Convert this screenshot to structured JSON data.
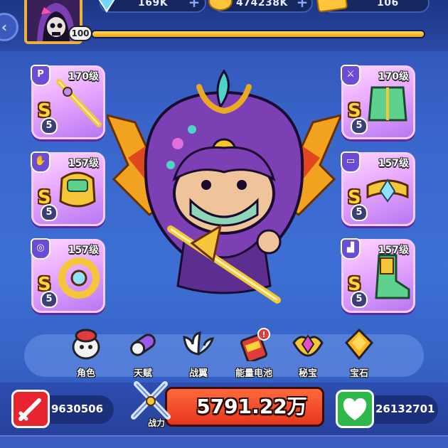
{
  "resources": {
    "gems": {
      "value": "169K",
      "icon": "diamond-icon"
    },
    "coins": {
      "value": "474238K",
      "icon": "gold-coin-icon"
    },
    "tickets": {
      "value": "106",
      "icon": "ticket-icon"
    }
  },
  "player": {
    "level": "100",
    "avatar": "reaper-avatar",
    "xp_fraction": 1.0
  },
  "equipment_left": [
    {
      "slot": "weapon",
      "level": "170级",
      "grade": "S",
      "stars": "5",
      "art": "golden-sword"
    },
    {
      "slot": "gloves",
      "level": "157级",
      "grade": "S",
      "stars": "5",
      "art": "golden-gauntlet"
    },
    {
      "slot": "necklace",
      "level": "157级",
      "grade": "S",
      "stars": "5",
      "art": "golden-amulet"
    }
  ],
  "equipment_right": [
    {
      "slot": "armor",
      "level": "170级",
      "grade": "S",
      "stars": "5",
      "art": "jade-armor"
    },
    {
      "slot": "belt",
      "level": "157级",
      "grade": "S",
      "stars": "5",
      "art": "golden-belt"
    },
    {
      "slot": "boots",
      "level": "157级",
      "grade": "S",
      "stars": "5",
      "art": "jade-boots"
    }
  ],
  "menu": [
    {
      "label": "角色",
      "icon": "character-icon"
    },
    {
      "label": "天赋",
      "icon": "talent-capsule-icon"
    },
    {
      "label": "战翼",
      "icon": "wings-icon"
    },
    {
      "label": "能量电池",
      "icon": "energy-battery-icon",
      "badge": "!"
    },
    {
      "label": "秘宝",
      "icon": "treasure-icon"
    },
    {
      "label": "宝石",
      "icon": "gem-icon"
    }
  ],
  "stats": {
    "attack": {
      "value": "9630506",
      "icon": "sword-icon",
      "color": "#e8242f"
    },
    "power": {
      "value": "5791.22万",
      "label": "战力",
      "icon": "crossed-swords-icon"
    },
    "health": {
      "value": "26132701",
      "icon": "heart-icon",
      "color": "#2eb84c"
    }
  }
}
